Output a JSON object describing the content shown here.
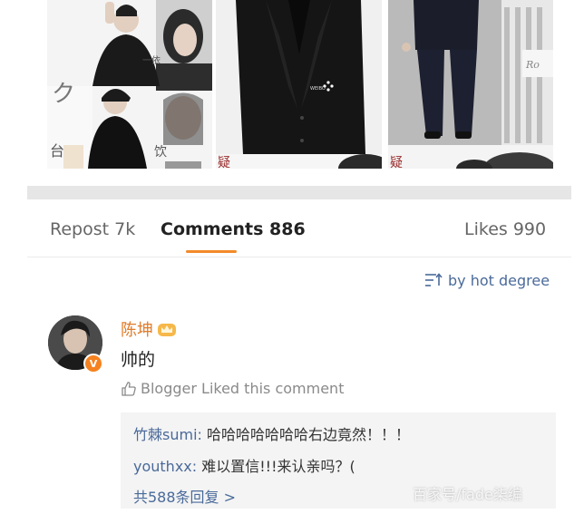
{
  "tabs": {
    "repost": "Repost 7k",
    "comments": "Comments 886",
    "likes": "Likes 990"
  },
  "sort": {
    "label": "by hot degree",
    "icon": "sort-icon"
  },
  "comment": {
    "username": "陈坤",
    "text": "帅的",
    "liked_note": "Blogger Liked this comment",
    "badge": "V",
    "colors": {
      "username": "#e07c2a",
      "badge": "#f58220",
      "link": "#4a6a9a"
    }
  },
  "replies": [
    {
      "user": "竹棘sumi",
      "sep": ": ",
      "text": "哈哈哈哈哈哈哈右边竟然！！！"
    },
    {
      "user": "youthxx",
      "sep": ": ",
      "text": "难以置信!!!来认亲吗？("
    }
  ],
  "more_replies": "共588条回复 >",
  "watermark": "百家号/fade柒编",
  "photo_text": {
    "p1_small": "一依",
    "p1_left": "台",
    "p1_right": "饮",
    "p2_stamp": "WEIBO",
    "p2_bottom": "疑",
    "p3_bottom": "疑",
    "p3_logo": "Ro"
  },
  "accent": "#f28a2a"
}
